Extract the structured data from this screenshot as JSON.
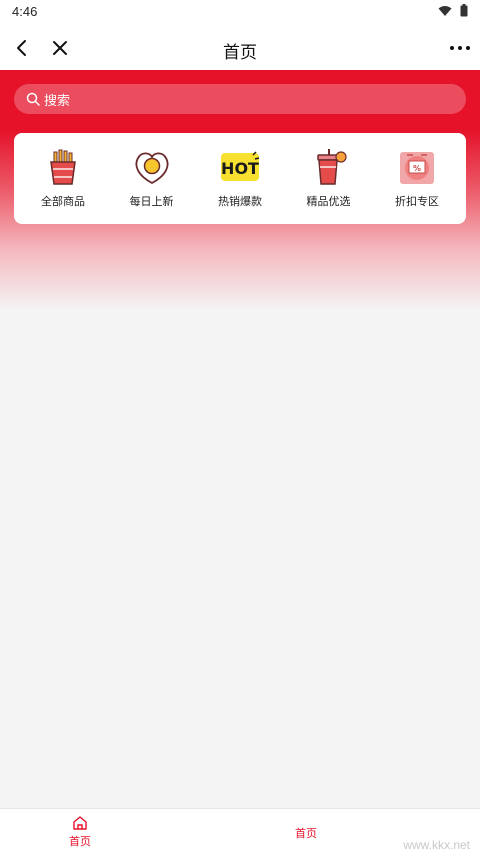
{
  "status_bar": {
    "time": "4:46"
  },
  "nav": {
    "title": "首页"
  },
  "search": {
    "placeholder": "搜索"
  },
  "categories": [
    {
      "label": "全部商品",
      "icon": "fries-icon"
    },
    {
      "label": "每日上新",
      "icon": "egg-icon"
    },
    {
      "label": "热销爆款",
      "icon": "hot-icon"
    },
    {
      "label": "精品优选",
      "icon": "drink-icon"
    },
    {
      "label": "折扣专区",
      "icon": "discount-icon"
    }
  ],
  "tabs": [
    {
      "label": "首页",
      "icon": "home-icon"
    },
    {
      "label": "首页"
    }
  ],
  "watermark": "www.kkx.net",
  "colors": {
    "accent": "#e5122a",
    "background": "#f4f4f4"
  }
}
